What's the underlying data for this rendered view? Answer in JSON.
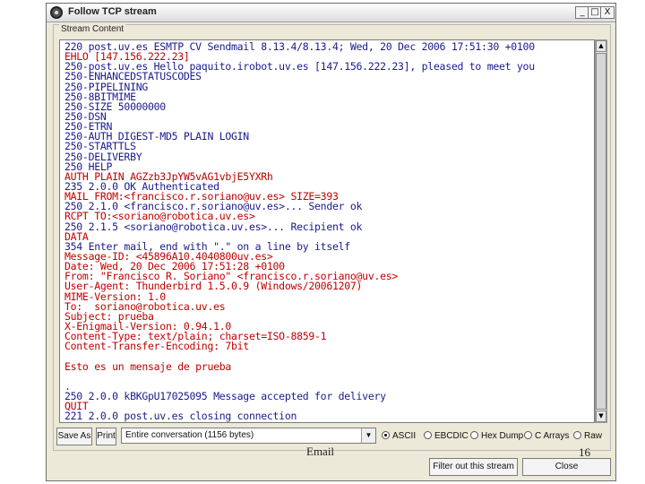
{
  "window": {
    "title": "Follow TCP stream",
    "min_label": "_",
    "max_label": "□",
    "close_label": "X"
  },
  "group": {
    "label": "Stream Content"
  },
  "stream": {
    "lines": [
      {
        "text": "220 post.uv.es ESMTP CV Sendmail 8.13.4/8.13.4; Wed, 20 Dec 2006 17:51:30 +0100",
        "dir": "server"
      },
      {
        "text": "EHLO [147.156.222.23]",
        "dir": "client"
      },
      {
        "text": "250-post.uv.es Hello paquito.irobot.uv.es [147.156.222.23], pleased to meet you",
        "dir": "server"
      },
      {
        "text": "250-ENHANCEDSTATUSCODES",
        "dir": "server"
      },
      {
        "text": "250-PIPELINING",
        "dir": "server"
      },
      {
        "text": "250-8BITMIME",
        "dir": "server"
      },
      {
        "text": "250-SIZE 50000000",
        "dir": "server"
      },
      {
        "text": "250-DSN",
        "dir": "server"
      },
      {
        "text": "250-ETRN",
        "dir": "server"
      },
      {
        "text": "250-AUTH DIGEST-MD5 PLAIN LOGIN",
        "dir": "server"
      },
      {
        "text": "250-STARTTLS",
        "dir": "server"
      },
      {
        "text": "250-DELIVERBY",
        "dir": "server"
      },
      {
        "text": "250 HELP",
        "dir": "server"
      },
      {
        "text": "AUTH PLAIN AGZzb3JpYW5vAG1vbjE5YXRh",
        "dir": "client"
      },
      {
        "text": "235 2.0.0 OK Authenticated",
        "dir": "server"
      },
      {
        "text": "MAIL FROM:<francisco.r.soriano@uv.es> SIZE=393",
        "dir": "client"
      },
      {
        "text": "250 2.1.0 <francisco.r.soriano@uv.es>... Sender ok",
        "dir": "server"
      },
      {
        "text": "RCPT TO:<soriano@robotica.uv.es>",
        "dir": "client"
      },
      {
        "text": "250 2.1.5 <soriano@robotica.uv.es>... Recipient ok",
        "dir": "server"
      },
      {
        "text": "DATA",
        "dir": "client"
      },
      {
        "text": "354 Enter mail, end with \".\" on a line by itself",
        "dir": "server"
      },
      {
        "text": "Message-ID: <45896A10.4040800uv.es>",
        "dir": "client"
      },
      {
        "text": "Date: Wed, 20 Dec 2006 17:51:28 +0100",
        "dir": "client"
      },
      {
        "text": "From: \"Francisco R. Soriano\" <francisco.r.soriano@uv.es>",
        "dir": "client"
      },
      {
        "text": "User-Agent: Thunderbird 1.5.0.9 (Windows/20061207)",
        "dir": "client"
      },
      {
        "text": "MIME-Version: 1.0",
        "dir": "client"
      },
      {
        "text": "To:  soriano@robotica.uv.es",
        "dir": "client"
      },
      {
        "text": "Subject: prueba",
        "dir": "client"
      },
      {
        "text": "X-Enigmail-Version: 0.94.1.0",
        "dir": "client"
      },
      {
        "text": "Content-Type: text/plain; charset=ISO-8859-1",
        "dir": "client"
      },
      {
        "text": "Content-Transfer-Encoding: 7bit",
        "dir": "client"
      },
      {
        "text": "",
        "dir": "client"
      },
      {
        "text": "Esto es un mensaje de prueba",
        "dir": "client"
      },
      {
        "text": "",
        "dir": "client"
      },
      {
        "text": ".",
        "dir": "client"
      },
      {
        "text": "250 2.0.0 kBKGpU17025095 Message accepted for delivery",
        "dir": "server"
      },
      {
        "text": "QUIT",
        "dir": "client"
      },
      {
        "text": "221 2.0.0 post.uv.es closing connection",
        "dir": "server"
      }
    ]
  },
  "controls": {
    "save_as": "Save As",
    "print": "Print",
    "conversation_select": "Entire conversation (1156 bytes)",
    "radio_options": [
      {
        "label": "ASCII",
        "selected": true
      },
      {
        "label": "EBCDIC",
        "selected": false
      },
      {
        "label": "Hex Dump",
        "selected": false
      },
      {
        "label": "C Arrays",
        "selected": false
      },
      {
        "label": "Raw",
        "selected": false
      }
    ],
    "filter_out": "Filter out this stream",
    "close": "Close"
  },
  "slide": {
    "footer_text": "Email",
    "page_number": "16"
  },
  "colors": {
    "client_text": "#c00000",
    "server_text": "#1a1a8c"
  }
}
